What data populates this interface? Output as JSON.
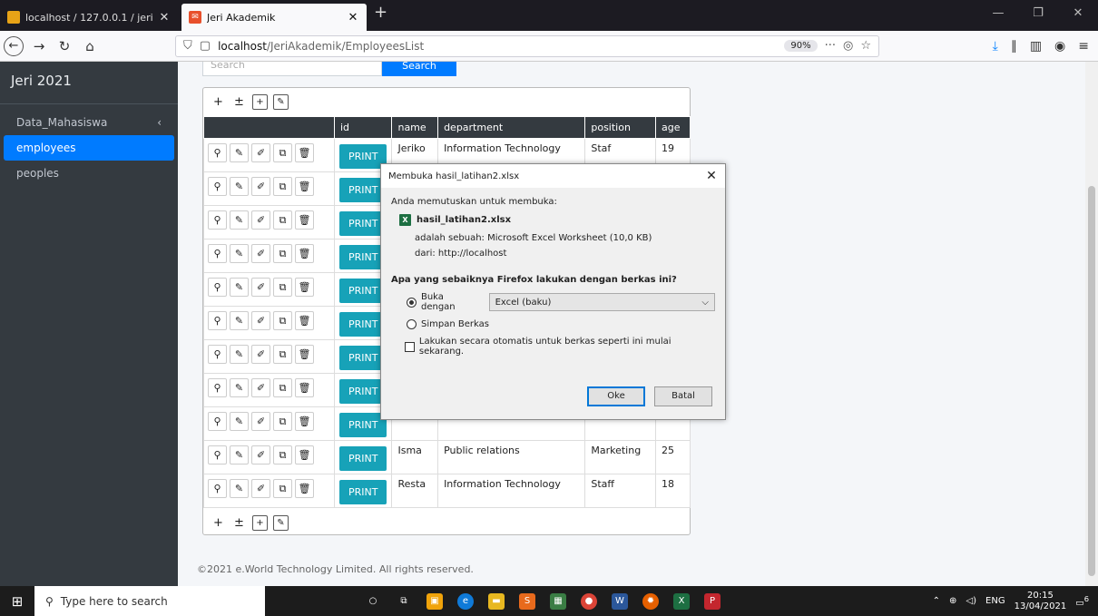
{
  "browser": {
    "tabs": [
      {
        "title": "localhost / 127.0.0.1 / jeri_acad",
        "close": "✕"
      },
      {
        "title": "Jeri Akademik",
        "close": "✕"
      }
    ],
    "url_prefix": "localhost",
    "url_path": "/JeriAkademik/EmployeesList",
    "zoom": "90%"
  },
  "sidebar": {
    "brand": "Jeri 2021",
    "items": [
      {
        "label": "Data_Mahasiswa",
        "arrow": "‹"
      },
      {
        "label": "employees"
      },
      {
        "label": "peoples"
      }
    ]
  },
  "search": {
    "placeholder": "Search",
    "button": "Search"
  },
  "grid": {
    "columns": [
      "",
      "id",
      "name",
      "department",
      "position",
      "age"
    ],
    "print_label": "PRINT",
    "rows": [
      {
        "name": "Jeriko",
        "department": "Information Technology",
        "position": "Staf",
        "age": "19"
      },
      {
        "name": "",
        "department": "",
        "position": "",
        "age": ""
      },
      {
        "name": "",
        "department": "",
        "position": "",
        "age": ""
      },
      {
        "name": "",
        "department": "",
        "position": "",
        "age": ""
      },
      {
        "name": "",
        "department": "",
        "position": "",
        "age": ""
      },
      {
        "name": "",
        "department": "",
        "position": "",
        "age": ""
      },
      {
        "name": "",
        "department": "",
        "position": "",
        "age": ""
      },
      {
        "name": "",
        "department": "",
        "position": "",
        "age": ""
      },
      {
        "name": "",
        "department": "",
        "position": "",
        "age": ""
      },
      {
        "name": "Isma",
        "department": "Public relations",
        "position": "Marketing",
        "age": "25"
      },
      {
        "name": "Resta",
        "department": "Information Technology",
        "position": "Staff",
        "age": "18"
      }
    ]
  },
  "footer": "©2021 e.World Technology Limited. All rights reserved.",
  "dialog": {
    "title": "Membuka hasil_latihan2.xlsx",
    "intro": "Anda memutuskan untuk membuka:",
    "filename": "hasil_latihan2.xlsx",
    "type_line": "adalah sebuah:  Microsoft Excel Worksheet (10,0 KB)",
    "from_line": "dari:  http://localhost",
    "question": "Apa yang sebaiknya Firefox lakukan dengan berkas ini?",
    "open_with_label": "Buka dengan",
    "open_with_value": "Excel (baku)",
    "save_label": "Simpan Berkas",
    "auto_label": "Lakukan secara otomatis untuk berkas seperti ini mulai sekarang.",
    "ok": "Oke",
    "cancel": "Batal"
  },
  "taskbar": {
    "search_placeholder": "Type here to search",
    "lang": "ENG",
    "time": "20:15",
    "date": "13/04/2021",
    "notif_count": "6"
  }
}
